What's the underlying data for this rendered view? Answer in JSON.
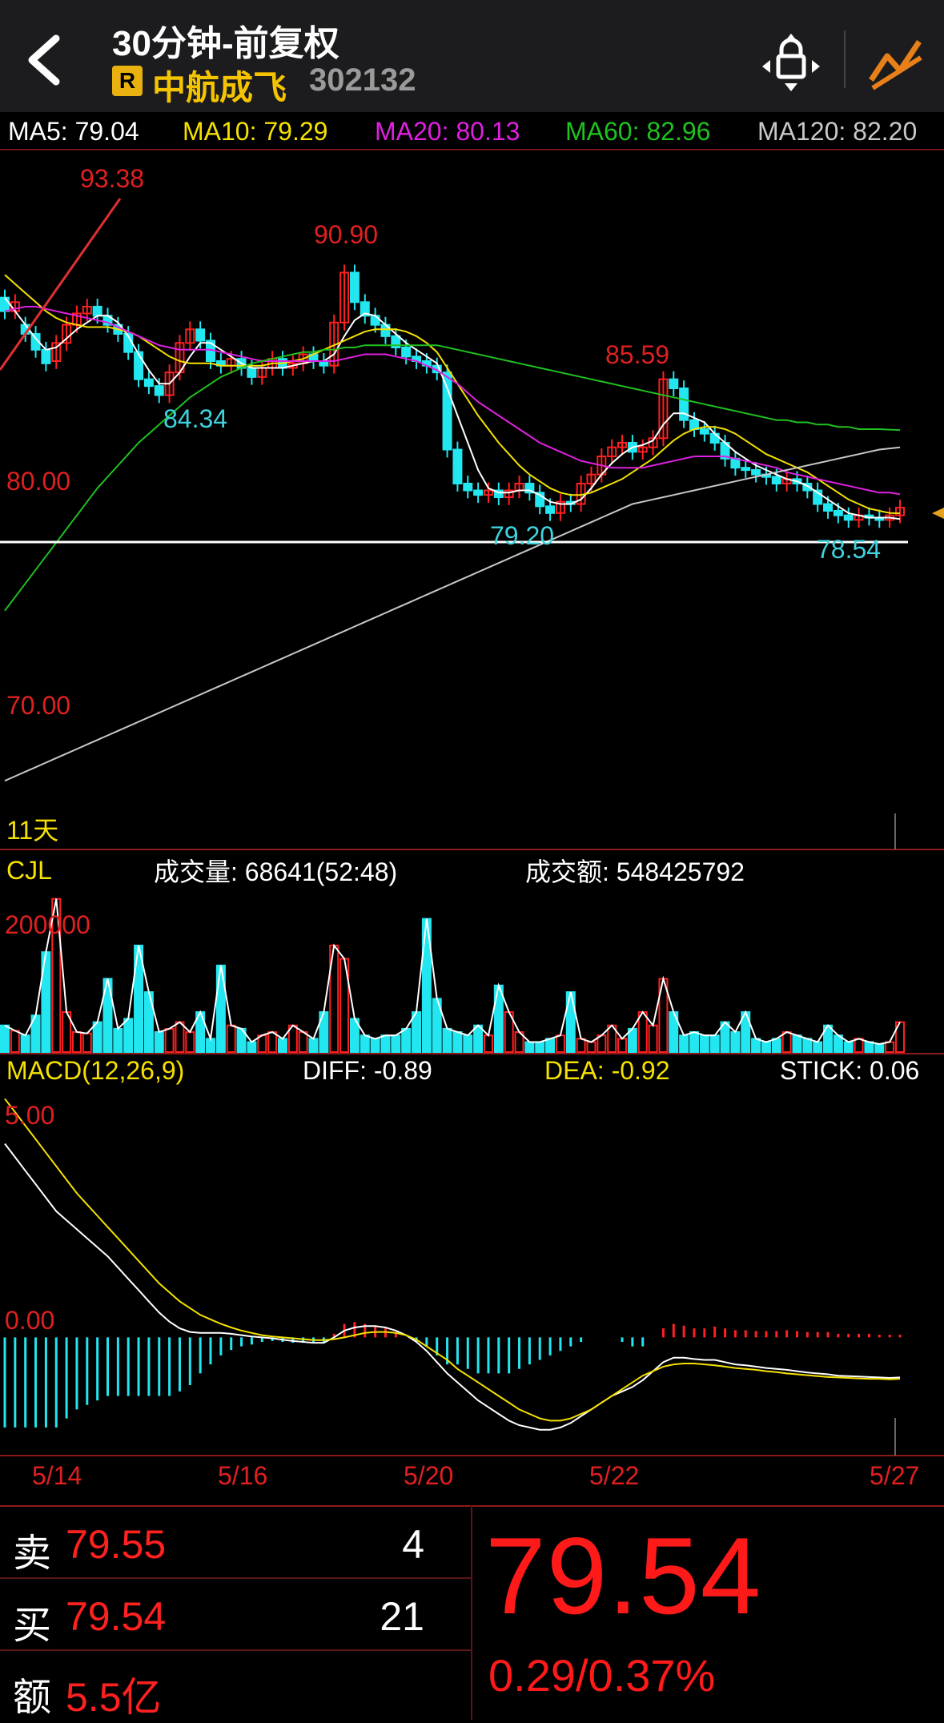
{
  "header": {
    "title": "30分钟-前复权",
    "badge": "R",
    "stock_name": "中航成飞",
    "stock_code": "302132"
  },
  "ma_legend": [
    {
      "label": "MA5: 79.04",
      "color": "#ffffff"
    },
    {
      "label": "MA10: 79.29",
      "color": "#f5e100"
    },
    {
      "label": "MA20: 80.13",
      "color": "#e020e0"
    },
    {
      "label": "MA60: 82.96",
      "color": "#20c020"
    },
    {
      "label": "MA120: 82.20",
      "color": "#c8c8c8"
    }
  ],
  "price_chart": {
    "y_labels": [
      "80.00",
      "70.00"
    ],
    "annotations": {
      "high1": "93.38",
      "high2": "90.90",
      "low1": "84.34",
      "high3": "85.59",
      "low2": "79.20",
      "low3": "78.54"
    },
    "period_label": "11天"
  },
  "volume": {
    "indicator": "CJL",
    "volume_text": "成交量: 68641(52:48)",
    "amount_text": "成交额: 548425792",
    "y_label": "200000"
  },
  "macd": {
    "title": "MACD(12,26,9)",
    "diff": "DIFF: -0.89",
    "dea": "DEA: -0.92",
    "stick": "STICK: 0.06",
    "y_labels": [
      "5.00",
      "0.00"
    ]
  },
  "x_axis": [
    "5/14",
    "5/16",
    "5/20",
    "5/22",
    "5/27"
  ],
  "orderbook": {
    "sell": {
      "label": "卖",
      "price": "79.55",
      "vol": "4"
    },
    "buy": {
      "label": "买",
      "price": "79.54",
      "vol": "21"
    },
    "amount": {
      "label": "额",
      "value": "5.5亿"
    }
  },
  "quote": {
    "price": "79.54",
    "change": "0.29/0.37%"
  },
  "colors": {
    "up": "#ff2020",
    "down": "#22e6f0",
    "accent": "#e8b10f",
    "grid": "#8b1a1a"
  },
  "chart_data": {
    "type": "candlestick",
    "ylim": [
      65,
      95
    ],
    "closes": [
      88.2,
      88.6,
      87.2,
      86.5,
      85.9,
      86.8,
      87.6,
      88.1,
      88.4,
      88.0,
      87.6,
      87.2,
      86.4,
      85.2,
      84.9,
      84.5,
      85.5,
      86.8,
      87.4,
      86.9,
      86.0,
      85.8,
      86.1,
      85.7,
      85.3,
      85.7,
      86.1,
      85.7,
      85.9,
      86.3,
      86.0,
      85.8,
      87.7,
      89.9,
      88.6,
      88.0,
      87.6,
      87.1,
      86.6,
      86.2,
      86.0,
      85.8,
      85.5,
      82.1,
      80.6,
      80.3,
      80.1,
      80.3,
      80.0,
      80.3,
      80.6,
      80.2,
      79.6,
      79.3,
      79.8,
      79.7,
      80.6,
      81.0,
      81.8,
      82.2,
      82.4,
      82.0,
      82.2,
      82.6,
      85.2,
      84.8,
      83.4,
      83.0,
      82.8,
      82.4,
      81.7,
      81.3,
      81.2,
      81.0,
      80.9,
      80.6,
      80.8,
      80.6,
      80.3,
      79.7,
      79.4,
      79.2,
      79.0,
      79.2,
      79.1,
      79.0,
      79.2,
      79.54
    ],
    "opens": [
      88.8,
      88.2,
      87.6,
      87.2,
      86.5,
      86.0,
      86.8,
      87.6,
      88.1,
      88.4,
      88.0,
      87.6,
      87.2,
      86.4,
      85.2,
      84.9,
      84.5,
      85.5,
      86.8,
      87.4,
      86.9,
      86.0,
      85.8,
      86.1,
      85.7,
      85.3,
      85.7,
      86.1,
      85.7,
      85.9,
      86.3,
      86.0,
      85.8,
      87.7,
      89.9,
      88.6,
      88.0,
      87.6,
      87.1,
      86.6,
      86.2,
      86.0,
      85.8,
      85.5,
      82.1,
      80.6,
      80.3,
      80.1,
      80.3,
      80.0,
      80.3,
      80.6,
      80.2,
      79.6,
      79.3,
      79.8,
      79.7,
      80.6,
      81.0,
      81.8,
      82.2,
      82.4,
      82.0,
      82.2,
      82.6,
      85.2,
      84.8,
      83.4,
      83.0,
      82.8,
      82.4,
      81.7,
      81.3,
      81.2,
      81.0,
      80.9,
      80.6,
      80.8,
      80.6,
      80.3,
      79.7,
      79.4,
      79.2,
      79.0,
      79.2,
      79.1,
      79.0,
      79.2
    ],
    "series": [
      {
        "name": "MA5",
        "values": [
          88.8,
          88.2,
          87.6,
          87.0,
          86.5,
          86.6,
          87.0,
          87.4,
          87.7,
          88.0,
          88.0,
          87.7,
          87.1,
          86.3,
          85.6,
          85.0,
          85.0,
          85.5,
          86.2,
          86.8,
          86.8,
          86.5,
          86.2,
          85.9,
          85.7,
          85.7,
          85.7,
          85.7,
          85.8,
          85.9,
          86.0,
          86.0,
          86.3,
          87.1,
          87.8,
          88.1,
          88.0,
          87.6,
          87.2,
          86.8,
          86.5,
          86.2,
          85.9,
          84.8,
          83.6,
          82.4,
          81.2,
          80.4,
          80.2,
          80.2,
          80.3,
          80.3,
          80.1,
          79.8,
          79.7,
          79.7,
          79.9,
          80.4,
          81.0,
          81.5,
          81.9,
          82.2,
          82.3,
          82.5,
          83.2,
          83.7,
          83.7,
          83.5,
          83.3,
          82.8,
          82.4,
          82.0,
          81.7,
          81.4,
          81.2,
          81.0,
          80.8,
          80.7,
          80.5,
          80.2,
          79.9,
          79.6,
          79.3,
          79.2,
          79.1,
          79.1,
          79.1,
          79.04
        ]
      },
      {
        "name": "MA10",
        "values": [
          89.8,
          89.4,
          89.0,
          88.6,
          88.2,
          87.9,
          87.7,
          87.6,
          87.5,
          87.5,
          87.5,
          87.4,
          87.3,
          87.1,
          86.8,
          86.5,
          86.2,
          86.0,
          85.9,
          85.9,
          85.9,
          85.8,
          85.8,
          85.8,
          85.8,
          85.8,
          85.9,
          85.9,
          86.0,
          86.1,
          86.3,
          86.5,
          86.7,
          86.9,
          87.1,
          87.3,
          87.4,
          87.4,
          87.4,
          87.3,
          87.1,
          86.8,
          86.4,
          85.7,
          85.0,
          84.3,
          83.6,
          83.0,
          82.4,
          81.9,
          81.4,
          81.0,
          80.7,
          80.4,
          80.2,
          80.1,
          80.1,
          80.2,
          80.4,
          80.6,
          80.8,
          81.1,
          81.4,
          81.7,
          82.1,
          82.5,
          82.8,
          83.0,
          83.1,
          83.1,
          83.0,
          82.8,
          82.5,
          82.2,
          81.9,
          81.7,
          81.5,
          81.3,
          81.1,
          80.8,
          80.5,
          80.2,
          79.9,
          79.7,
          79.5,
          79.4,
          79.3,
          79.29
        ]
      },
      {
        "name": "MA20",
        "values": [
          88.2,
          88.3,
          88.4,
          88.4,
          88.3,
          88.2,
          88.1,
          88.0,
          87.9,
          87.8,
          87.7,
          87.5,
          87.3,
          87.1,
          86.9,
          86.7,
          86.6,
          86.5,
          86.5,
          86.5,
          86.5,
          86.4,
          86.3,
          86.2,
          86.1,
          86.0,
          86.0,
          86.0,
          86.0,
          86.0,
          86.0,
          86.0,
          86.0,
          86.1,
          86.2,
          86.3,
          86.3,
          86.3,
          86.2,
          86.1,
          86.0,
          85.8,
          85.6,
          85.3,
          85.0,
          84.6,
          84.2,
          83.9,
          83.6,
          83.3,
          83.0,
          82.7,
          82.4,
          82.2,
          82.0,
          81.8,
          81.6,
          81.5,
          81.4,
          81.3,
          81.3,
          81.3,
          81.3,
          81.4,
          81.5,
          81.6,
          81.7,
          81.8,
          81.8,
          81.8,
          81.8,
          81.7,
          81.6,
          81.5,
          81.4,
          81.3,
          81.1,
          81.0,
          80.9,
          80.8,
          80.7,
          80.6,
          80.5,
          80.4,
          80.3,
          80.2,
          80.2,
          80.13
        ]
      },
      {
        "name": "MA60",
        "values": [
          75.0,
          75.6,
          76.2,
          76.8,
          77.4,
          78.0,
          78.6,
          79.2,
          79.8,
          80.4,
          80.9,
          81.4,
          81.9,
          82.4,
          82.8,
          83.2,
          83.6,
          84.0,
          84.4,
          84.7,
          85.0,
          85.3,
          85.5,
          85.7,
          85.9,
          86.0,
          86.1,
          86.2,
          86.3,
          86.4,
          86.4,
          86.5,
          86.5,
          86.6,
          86.6,
          86.7,
          86.7,
          86.7,
          86.7,
          86.7,
          86.7,
          86.7,
          86.7,
          86.6,
          86.5,
          86.4,
          86.3,
          86.2,
          86.1,
          86.0,
          85.9,
          85.8,
          85.7,
          85.6,
          85.5,
          85.4,
          85.3,
          85.2,
          85.1,
          85.0,
          84.9,
          84.8,
          84.7,
          84.6,
          84.5,
          84.4,
          84.3,
          84.2,
          84.1,
          84.0,
          83.9,
          83.8,
          83.7,
          83.6,
          83.5,
          83.4,
          83.4,
          83.3,
          83.3,
          83.2,
          83.2,
          83.1,
          83.1,
          83.0,
          83.0,
          83.0,
          82.98,
          82.96
        ]
      },
      {
        "name": "MA120",
        "values": [
          67.5,
          67.7,
          67.9,
          68.1,
          68.3,
          68.5,
          68.7,
          68.9,
          69.1,
          69.3,
          69.5,
          69.7,
          69.9,
          70.1,
          70.3,
          70.5,
          70.7,
          70.9,
          71.1,
          71.3,
          71.5,
          71.7,
          71.9,
          72.1,
          72.3,
          72.5,
          72.7,
          72.9,
          73.1,
          73.3,
          73.5,
          73.7,
          73.9,
          74.1,
          74.3,
          74.5,
          74.7,
          74.9,
          75.1,
          75.3,
          75.5,
          75.7,
          75.9,
          76.1,
          76.3,
          76.5,
          76.7,
          76.9,
          77.1,
          77.3,
          77.5,
          77.7,
          77.9,
          78.1,
          78.3,
          78.5,
          78.7,
          78.9,
          79.1,
          79.3,
          79.5,
          79.7,
          79.8,
          79.9,
          80.0,
          80.1,
          80.2,
          80.3,
          80.4,
          80.5,
          80.6,
          80.7,
          80.8,
          80.9,
          81.0,
          81.1,
          81.2,
          81.3,
          81.4,
          81.5,
          81.6,
          81.7,
          81.8,
          81.9,
          82.0,
          82.1,
          82.15,
          82.2
        ]
      }
    ],
    "volume_ylim": [
      0,
      250000
    ],
    "volumes": [
      40000,
      32000,
      25000,
      55000,
      150000,
      230000,
      60000,
      30000,
      28000,
      45000,
      110000,
      35000,
      50000,
      160000,
      90000,
      30000,
      35000,
      45000,
      30000,
      60000,
      20000,
      130000,
      40000,
      35000,
      15000,
      25000,
      30000,
      20000,
      40000,
      30000,
      20000,
      60000,
      160000,
      140000,
      50000,
      25000,
      20000,
      25000,
      25000,
      35000,
      60000,
      200000,
      80000,
      35000,
      30000,
      25000,
      40000,
      25000,
      100000,
      60000,
      30000,
      15000,
      15000,
      20000,
      25000,
      90000,
      20000,
      15000,
      25000,
      40000,
      20000,
      35000,
      60000,
      40000,
      110000,
      60000,
      25000,
      30000,
      25000,
      25000,
      45000,
      30000,
      60000,
      20000,
      15000,
      20000,
      30000,
      25000,
      20000,
      15000,
      40000,
      25000,
      15000,
      20000,
      15000,
      12000,
      15000,
      45000
    ],
    "macd_ylim": [
      -2.5,
      5.5
    ],
    "diff": [
      4.3,
      4.0,
      3.7,
      3.4,
      3.1,
      2.8,
      2.6,
      2.4,
      2.2,
      2.0,
      1.8,
      1.55,
      1.3,
      1.05,
      0.8,
      0.55,
      0.35,
      0.2,
      0.12,
      0.1,
      0.1,
      0.1,
      0.08,
      0.05,
      0.02,
      0.0,
      -0.02,
      -0.05,
      -0.08,
      -0.1,
      -0.12,
      -0.12,
      0.0,
      0.15,
      0.22,
      0.25,
      0.25,
      0.22,
      0.15,
      0.05,
      -0.1,
      -0.3,
      -0.55,
      -0.8,
      -1.0,
      -1.2,
      -1.4,
      -1.55,
      -1.7,
      -1.85,
      -1.95,
      -2.0,
      -2.05,
      -2.05,
      -2.0,
      -1.9,
      -1.75,
      -1.6,
      -1.45,
      -1.3,
      -1.2,
      -1.1,
      -0.95,
      -0.75,
      -0.55,
      -0.45,
      -0.45,
      -0.48,
      -0.5,
      -0.5,
      -0.55,
      -0.6,
      -0.62,
      -0.65,
      -0.68,
      -0.7,
      -0.72,
      -0.75,
      -0.78,
      -0.8,
      -0.82,
      -0.85,
      -0.86,
      -0.87,
      -0.88,
      -0.89,
      -0.9,
      -0.89
    ],
    "dea": [
      5.3,
      5.0,
      4.7,
      4.4,
      4.1,
      3.8,
      3.5,
      3.2,
      2.95,
      2.7,
      2.45,
      2.2,
      1.95,
      1.7,
      1.45,
      1.2,
      1.0,
      0.8,
      0.65,
      0.5,
      0.4,
      0.3,
      0.22,
      0.15,
      0.1,
      0.05,
      0.02,
      0.0,
      -0.02,
      -0.04,
      -0.06,
      -0.06,
      -0.04,
      0.0,
      0.05,
      0.1,
      0.12,
      0.12,
      0.1,
      0.05,
      -0.05,
      -0.2,
      -0.35,
      -0.5,
      -0.7,
      -0.85,
      -1.0,
      -1.15,
      -1.3,
      -1.45,
      -1.6,
      -1.7,
      -1.8,
      -1.85,
      -1.85,
      -1.8,
      -1.7,
      -1.6,
      -1.45,
      -1.3,
      -1.15,
      -1.0,
      -0.85,
      -0.75,
      -0.65,
      -0.6,
      -0.58,
      -0.58,
      -0.6,
      -0.62,
      -0.65,
      -0.68,
      -0.7,
      -0.72,
      -0.75,
      -0.77,
      -0.8,
      -0.82,
      -0.84,
      -0.86,
      -0.88,
      -0.89,
      -0.9,
      -0.91,
      -0.92,
      -0.92,
      -0.93,
      -0.92
    ]
  }
}
